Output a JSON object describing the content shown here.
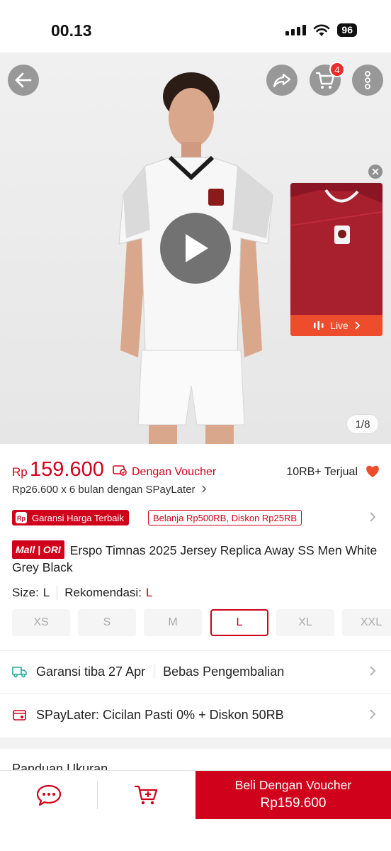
{
  "status_bar": {
    "time": "00.13",
    "battery": "96"
  },
  "hero": {
    "cart_count": "4",
    "page_counter": "1/8",
    "live_label": "Live"
  },
  "price": {
    "currency": "Rp",
    "value": "159.600",
    "voucher_label": "Dengan Voucher",
    "sold": "10RB+ Terjual",
    "installment": "Rp26.600 x 6 bulan dengan SPayLater"
  },
  "badges": {
    "guarantee": "Garansi Harga Terbaik",
    "promo": "Belanja Rp500RB, Diskon Rp25RB"
  },
  "product": {
    "mall_tag": "Mall | ORI",
    "title": "Erspo Timnas 2025 Jersey Replica Away SS Men White Grey Black"
  },
  "size": {
    "label": "Size:",
    "value": "L",
    "recommendation_label": "Rekomendasi:",
    "recommendation_value": "L",
    "options": [
      "XS",
      "S",
      "M",
      "L",
      "XL",
      "XXL"
    ],
    "selected": "L"
  },
  "shipping": {
    "arrival": "Garansi tiba 27 Apr",
    "returns": "Bebas Pengembalian"
  },
  "spaylater": {
    "text": "SPayLater: Cicilan Pasti 0% + Diskon 50RB"
  },
  "guide": {
    "label": "Panduan Ukuran"
  },
  "bottom": {
    "buy_label": "Beli Dengan Voucher",
    "buy_price": "Rp159.600"
  },
  "colors": {
    "brand_red": "#d0011b",
    "live_orange": "#ee4d2d"
  }
}
